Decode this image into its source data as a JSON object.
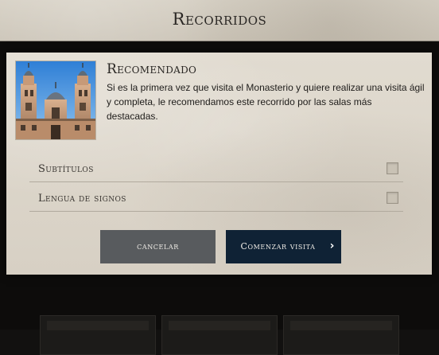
{
  "header": {
    "title": "Recorridos"
  },
  "modal": {
    "image_name": "monastery-towers-image",
    "section_title": "Recomendado",
    "description": "Si es la primera vez que visita el Monasterio y quiere realizar una visita ágil y completa, le recomendamos este recorrido por las salas más destacadas.",
    "options": [
      {
        "label": "Subtítulos",
        "checked": false
      },
      {
        "label": "Lengua de signos",
        "checked": false
      }
    ],
    "buttons": {
      "cancel_label": "cancelar",
      "start_label": "Comenzar visita",
      "start_icon": "chevron-right-icon"
    }
  },
  "colors": {
    "cancel_button": "#585b5e",
    "start_button": "#0f2235",
    "parchment": "#dcd6ca"
  }
}
